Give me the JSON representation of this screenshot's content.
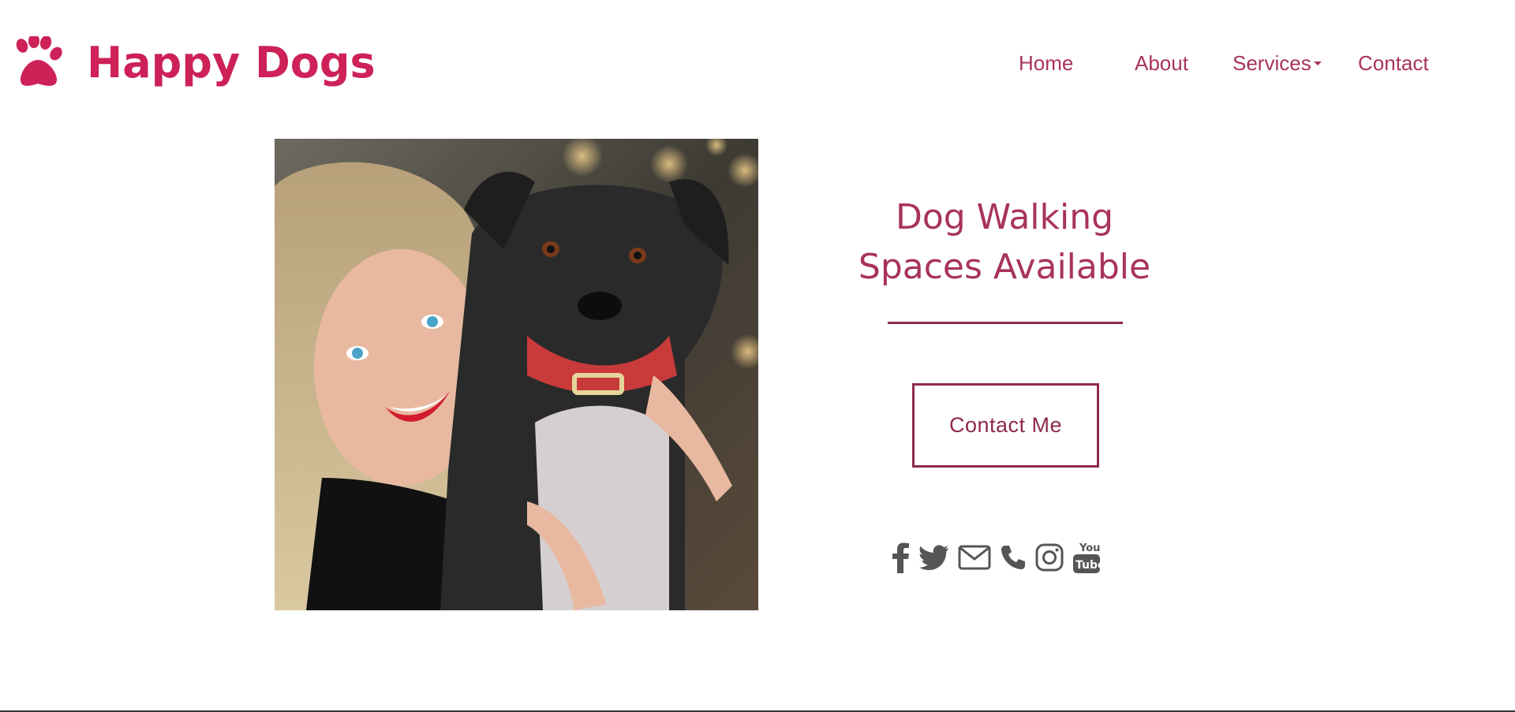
{
  "brand": {
    "name": "Happy Dogs",
    "icon": "paw-icon",
    "color": "#cd2158"
  },
  "nav": {
    "items": [
      {
        "label": "Home"
      },
      {
        "label": "About"
      },
      {
        "label": "Services",
        "has_dropdown": true
      },
      {
        "label": "Contact"
      }
    ],
    "color": "#a8335c"
  },
  "hero": {
    "image": "woman-holding-black-dog-photo",
    "headline_line1": "Dog Walking",
    "headline_line2": "Spaces Available",
    "cta_label": "Contact Me",
    "accent_color": "#8e2a4c"
  },
  "social": {
    "icons": [
      "facebook-icon",
      "twitter-icon",
      "email-icon",
      "phone-icon",
      "instagram-icon",
      "youtube-icon"
    ],
    "youtube_text_top": "You",
    "youtube_text_bottom": "Tube",
    "color": "#555555"
  }
}
